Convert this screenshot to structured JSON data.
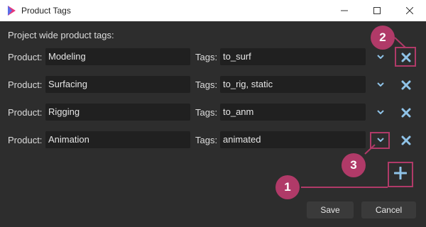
{
  "window": {
    "title": "Product Tags"
  },
  "section_label": "Project wide product tags:",
  "labels": {
    "product": "Product:",
    "tags": "Tags:"
  },
  "rows": [
    {
      "product": "Modeling",
      "tags": "to_surf"
    },
    {
      "product": "Surfacing",
      "tags": "to_rig, static"
    },
    {
      "product": "Rigging",
      "tags": "to_anm"
    },
    {
      "product": "Animation",
      "tags": "animated"
    }
  ],
  "buttons": {
    "save": "Save",
    "cancel": "Cancel"
  },
  "callouts": {
    "add": "1",
    "delete": "2",
    "dropdown": "3"
  },
  "colors": {
    "accent_icon": "#8fc3e8",
    "callout": "#b03a68",
    "field_bg": "#202020",
    "window_bg": "#2d2d2d"
  },
  "icons": {
    "app": "app-logo-icon",
    "minimize": "minimize-icon",
    "maximize": "maximize-icon",
    "close": "close-icon",
    "dropdown": "chevron-down-icon",
    "delete": "x-icon",
    "add": "plus-icon"
  }
}
